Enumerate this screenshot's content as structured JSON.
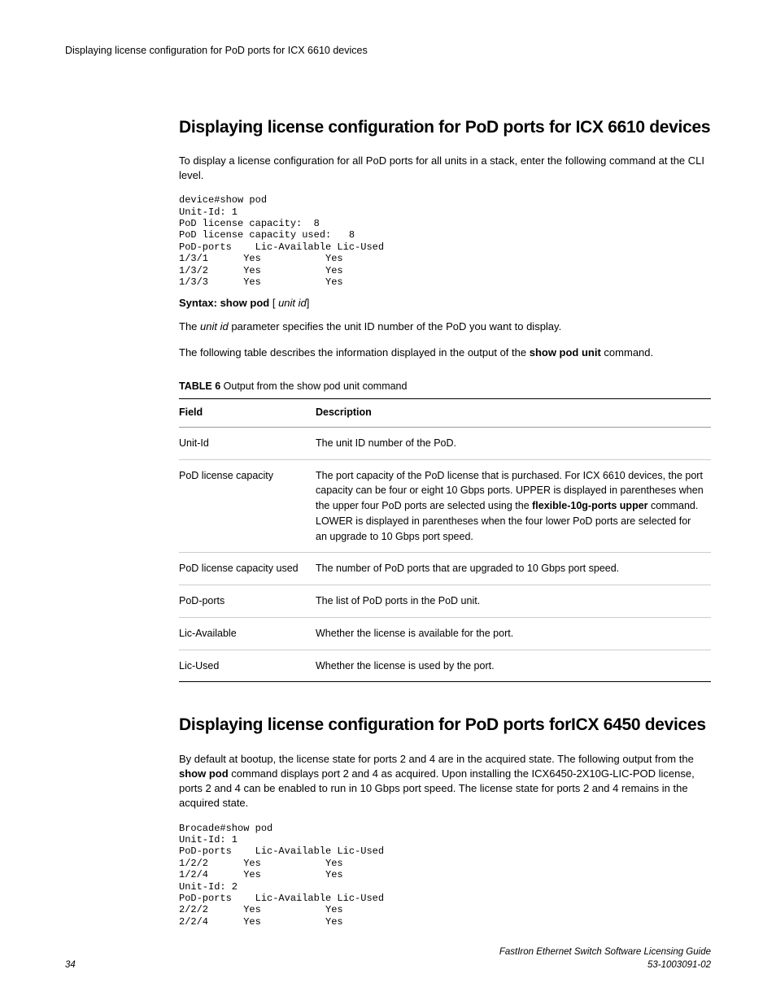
{
  "header": {
    "running": "Displaying license configuration for PoD ports for ICX 6610 devices"
  },
  "section1": {
    "title": "Displaying license configuration for PoD ports for ICX 6610 devices",
    "intro": "To display a license configuration for all PoD ports for all units in a stack, enter the following command at the CLI level.",
    "cli": "device#show pod\nUnit-Id: 1 \nPoD license capacity:  8\nPoD license capacity used:   8\nPoD-ports    Lic-Available Lic-Used\n1/3/1      Yes           Yes  \n1/3/2      Yes           Yes  \n1/3/3      Yes           Yes",
    "syntax_label": "Syntax: show pod",
    "syntax_arg_open": " [ ",
    "syntax_arg": "unit id",
    "syntax_arg_close": "]",
    "param_pre": "The ",
    "param_ital": "unit id",
    "param_post": " parameter specifies the unit ID number of the PoD you want to display.",
    "table_intro_pre": "The following table describes the information displayed in the output of the ",
    "table_intro_bold": "show pod unit",
    "table_intro_post": " command.",
    "table_caption_bold": "TABLE 6",
    "table_caption_rest": "   Output from the show pod unit command",
    "table": {
      "head_field": "Field",
      "head_desc": "Description",
      "rows": [
        {
          "field": "Unit-Id",
          "desc_pre": "The unit ID number of the PoD.",
          "desc_bold": "",
          "desc_post": ""
        },
        {
          "field": "PoD license capacity",
          "desc_pre": "The port capacity of the PoD license that is purchased. For ICX 6610 devices, the port capacity can be four or eight 10 Gbps ports. UPPER is displayed in parentheses when the upper four PoD ports are selected using the ",
          "desc_bold": "flexible-10g-ports upper",
          "desc_post": " command. LOWER is displayed in parentheses when the four lower PoD ports are selected for an upgrade to 10 Gbps port speed."
        },
        {
          "field": "PoD license capacity used",
          "desc_pre": "The number of PoD ports that are upgraded to 10 Gbps port speed.",
          "desc_bold": "",
          "desc_post": ""
        },
        {
          "field": "PoD-ports",
          "desc_pre": "The list of PoD ports in the PoD unit.",
          "desc_bold": "",
          "desc_post": ""
        },
        {
          "field": "Lic-Available",
          "desc_pre": "Whether the license is available for the port.",
          "desc_bold": "",
          "desc_post": ""
        },
        {
          "field": "Lic-Used",
          "desc_pre": "Whether the license is used by the port.",
          "desc_bold": "",
          "desc_post": ""
        }
      ]
    }
  },
  "section2": {
    "title": "Displaying license configuration for PoD ports forICX 6450 devices",
    "intro_pre": "By default at bootup, the license state for ports 2 and 4 are in the acquired state. The following output from the ",
    "intro_bold": "show pod",
    "intro_post": " command displays port 2 and 4 as acquired. Upon installing the ICX6450-2X10G-LIC-POD license, ports 2 and 4 can be enabled to run in 10 Gbps port speed. The license state for ports 2 and 4 remains in the acquired state.",
    "cli": "Brocade#show pod\nUnit-Id: 1\nPoD-ports    Lic-Available Lic-Used\n1/2/2      Yes           Yes  \n1/2/4      Yes           Yes  \nUnit-Id: 2\nPoD-ports    Lic-Available Lic-Used\n2/2/2      Yes           Yes  \n2/2/4      Yes           Yes"
  },
  "footer": {
    "page": "34",
    "title": "FastIron Ethernet Switch Software Licensing Guide",
    "docnum": "53-1003091-02"
  }
}
